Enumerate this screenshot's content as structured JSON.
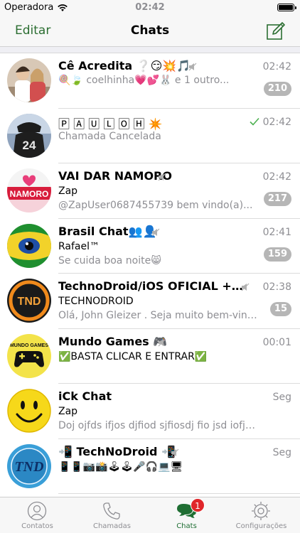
{
  "status_bar": {
    "carrier": "Operadora",
    "time": "02:42"
  },
  "nav": {
    "edit_label": "Editar",
    "title": "Chats"
  },
  "chats": [
    {
      "name": "Cê Acredita ❔😏💥🎵",
      "time": "02:42",
      "line1": "",
      "line2": "🍭🍃 coelhinha💗💕🐰 e 1 outro...",
      "badge": "210",
      "muted": true
    },
    {
      "name": "🄿 🄰 🅄 🄻 🄾 🄷 ✴️",
      "time": "02:42",
      "line1": "",
      "line2": "Chamada Cancelada",
      "badge": "",
      "muted": false,
      "read_tick": true
    },
    {
      "name": "VAI DAR NAMORO",
      "time": "02:42",
      "line1": "Zap",
      "line2": "@ZapUser0687455739 bem vindo(a)...",
      "badge": "217",
      "muted": true
    },
    {
      "name": "Brasil Chat👥👤",
      "time": "02:41",
      "line1": "Rafael™",
      "line2": "Se cuida boa noite😸",
      "badge": "159",
      "muted": true
    },
    {
      "name": "TechnoDroid/iOS OFICIAL +Net...",
      "time": "02:38",
      "line1": "TECHNODROID",
      "line2": "Olá, John Gleizer . Seja muito bem-vind...",
      "badge": "15",
      "muted": true
    },
    {
      "name": "Mundo Games 🎮",
      "time": "00:01",
      "line1": "✅BASTA CLICAR E ENTRAR✅",
      "line2": "",
      "badge": "",
      "muted": true
    },
    {
      "name": "iCk Chat",
      "time": "Seg",
      "line1": "Zap",
      "line2": "Doj ojfds ifjos djfiod sjfiosdj fio jsd iofjdsofjo d...",
      "badge": "",
      "muted": false
    },
    {
      "name": "📲 TechNoDroid 📲",
      "time": "Seg",
      "line1": "📱📱📷📸🕹🕹🎤🎧💻🖥",
      "line2": "",
      "badge": "",
      "muted": true
    }
  ],
  "avatar_texts": {
    "tnd": "TND",
    "mundo": "MUNDO GAMES",
    "namoro": "NAMORO",
    "jersey": "24"
  },
  "tabs": [
    {
      "label": "Contatos",
      "icon": "person-icon"
    },
    {
      "label": "Chamadas",
      "icon": "phone-icon"
    },
    {
      "label": "Chats",
      "icon": "chat-bubbles-icon",
      "badge": "1"
    },
    {
      "label": "Configurações",
      "icon": "gear-icon"
    }
  ],
  "colors": {
    "accent": "#2c6e32",
    "badge": "#b6b6b6",
    "tab_badge": "#e0262a",
    "tick": "#4cb050"
  }
}
